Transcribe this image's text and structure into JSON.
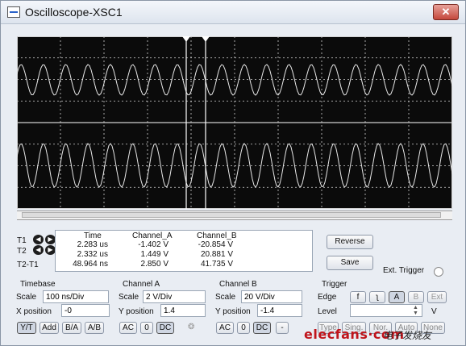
{
  "window": {
    "title": "Oscilloscope-XSC1",
    "close_glyph": "✕"
  },
  "cursors": {
    "t1_label": "T1",
    "t2_label": "T2",
    "t2t1_label": "T2-T1"
  },
  "readout": {
    "headers": [
      "Time",
      "Channel_A",
      "Channel_B"
    ],
    "rows": [
      [
        "2.283 us",
        "-1.402 V",
        "-20.854 V"
      ],
      [
        "2.332 us",
        "1.449 V",
        "20.881 V"
      ],
      [
        "48.964 ns",
        "2.850 V",
        "41.735 V"
      ]
    ]
  },
  "buttons": {
    "reverse": "Reverse",
    "save": "Save"
  },
  "ext_trigger": {
    "label": "Ext. Trigger"
  },
  "timebase": {
    "header": "Timebase",
    "scale_label": "Scale",
    "scale_value": "100 ns/Div",
    "xpos_label": "X position",
    "xpos_value": "-0",
    "modes": [
      "Y/T",
      "Add",
      "B/A",
      "A/B"
    ]
  },
  "channel_a": {
    "header": "Channel A",
    "scale_label": "Scale",
    "scale_value": "2  V/Div",
    "ypos_label": "Y position",
    "ypos_value": "1.4",
    "coupling": [
      "AC",
      "0",
      "DC"
    ]
  },
  "channel_b": {
    "header": "Channel B",
    "scale_label": "Scale",
    "scale_value": "20  V/Div",
    "ypos_label": "Y position",
    "ypos_value": "-1.4",
    "coupling": [
      "AC",
      "0",
      "DC",
      "-"
    ]
  },
  "trigger": {
    "header": "Trigger",
    "edge_label": "Edge",
    "edge_buttons": [
      "f",
      "ʅ",
      "A",
      "B",
      "Ext"
    ],
    "level_label": "Level",
    "level_value": "",
    "level_unit": "V",
    "mode_buttons": [
      "Type",
      "Sing.",
      "Nor.",
      "Auto",
      "None"
    ]
  },
  "watermark": {
    "brand": "elecfans·com",
    "cn": "电子发烧友"
  },
  "colors": {
    "screen": "#0b0b0b",
    "grid": "#d0d0d0",
    "trace": "#e8e8e8"
  }
}
